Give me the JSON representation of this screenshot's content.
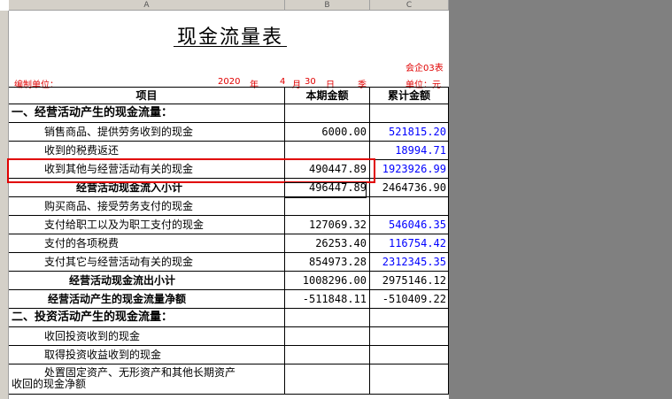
{
  "columns": {
    "a": "A",
    "b": "B",
    "c": "C"
  },
  "title": "现金流量表",
  "form_code": "会企03表",
  "unit": "单位：元",
  "prepared_by_label": "编制单位：",
  "date": {
    "year": "2020",
    "year_label": "年",
    "month": "4",
    "month_label": "月",
    "day": "30",
    "day_label": "日",
    "period": "季"
  },
  "headers": {
    "item": "项目",
    "current": "本期金额",
    "cumulative": "累计金额"
  },
  "rows": [
    {
      "label": "一、经营活动产生的现金流量：",
      "current": "",
      "cumulative": "",
      "style": "section"
    },
    {
      "label": "销售商品、提供劳务收到的现金",
      "current": "6000.00",
      "cumulative": "521815.20",
      "style": "item",
      "cum_blue": true
    },
    {
      "label": "收到的税费返还",
      "current": "",
      "cumulative": "18994.71",
      "style": "item",
      "cum_blue": true
    },
    {
      "label": "收到其他与经营活动有关的现金",
      "current": "490447.89",
      "cumulative": "1923926.99",
      "style": "item",
      "cum_blue": true
    },
    {
      "label": "经营活动现金流入小计",
      "current": "496447.89",
      "cumulative": "2464736.90",
      "style": "subtotal"
    },
    {
      "label": "购买商品、接受劳务支付的现金",
      "current": "",
      "cumulative": "",
      "style": "item"
    },
    {
      "label": "支付给职工以及为职工支付的现金",
      "current": "127069.32",
      "cumulative": "546046.35",
      "style": "item",
      "cum_blue": true
    },
    {
      "label": "支付的各项税费",
      "current": "26253.40",
      "cumulative": "116754.42",
      "style": "item",
      "cum_blue": true
    },
    {
      "label": "支付其它与经营活动有关的现金",
      "current": "854973.28",
      "cumulative": "2312345.35",
      "style": "item",
      "cum_blue": true
    },
    {
      "label": "经营活动现金流出小计",
      "current": "1008296.00",
      "cumulative": "2975146.12",
      "style": "subtotal2"
    },
    {
      "label": "经营活动产生的现金流量净额",
      "current": "-511848.11",
      "cumulative": "-510409.22",
      "style": "net"
    },
    {
      "label": "二、投资活动产生的现金流量：",
      "current": "",
      "cumulative": "",
      "style": "section"
    },
    {
      "label": "收回投资收到的现金",
      "current": "",
      "cumulative": "",
      "style": "item"
    },
    {
      "label": "取得投资收益收到的现金",
      "current": "",
      "cumulative": "",
      "style": "item"
    },
    {
      "label_line1": "处置固定资产、无形资产和其他长期资产",
      "label_line2": "收回的现金净额",
      "current": "",
      "cumulative": "",
      "style": "multi"
    }
  ]
}
